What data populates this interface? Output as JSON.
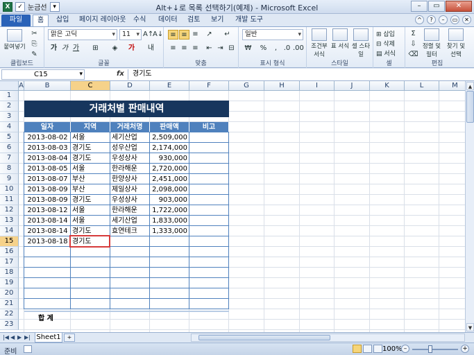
{
  "window": {
    "title": "Alt+↓로 목록 선택하기(예제) - Microsoft Excel",
    "qat_label": "눈금선"
  },
  "ribbon_tabs": [
    {
      "label": "파일"
    },
    {
      "label": "홈"
    },
    {
      "label": "삽입"
    },
    {
      "label": "페이지 레이아웃"
    },
    {
      "label": "수식"
    },
    {
      "label": "데이터"
    },
    {
      "label": "검토"
    },
    {
      "label": "보기"
    },
    {
      "label": "개발 도구"
    }
  ],
  "ribbon": {
    "clipboard": {
      "paste": "붙여넣기",
      "label": "클립보드"
    },
    "font": {
      "name": "맑은 고딕",
      "size": "11",
      "bold": "가",
      "italic": "가",
      "underline": "가",
      "label": "글꼴"
    },
    "alignment": {
      "label": "맞춤"
    },
    "number": {
      "format": "일반",
      "label": "표시 형식"
    },
    "styles": {
      "conditional": "조건부 서식",
      "table": "표 서식",
      "cell": "셀 스타일",
      "label": "스타일"
    },
    "cells": {
      "insert": "삽입",
      "delete": "삭제",
      "format": "서식",
      "label": "셀"
    },
    "editing": {
      "sort": "정렬 및 필터",
      "find": "찾기 및 선택",
      "label": "편집"
    }
  },
  "formula_bar": {
    "name_box": "C15",
    "fx": "fx",
    "value": "경기도"
  },
  "columns": [
    "A",
    "B",
    "C",
    "D",
    "E",
    "F",
    "G",
    "H",
    "I",
    "J",
    "K",
    "L",
    "M"
  ],
  "rows": [
    "1",
    "2",
    "3",
    "4",
    "5",
    "6",
    "7",
    "8",
    "9",
    "10",
    "11",
    "12",
    "13",
    "14",
    "15",
    "16",
    "17",
    "18",
    "19",
    "20",
    "21",
    "22",
    "23"
  ],
  "sheet": {
    "title": "거래처별 판매내역",
    "headers": [
      "일자",
      "지역",
      "거래처명",
      "판매액",
      "비고"
    ],
    "data": [
      [
        "2013-08-02",
        "서울",
        "세기산업",
        "2,509,000",
        ""
      ],
      [
        "2013-08-03",
        "경기도",
        "성우산업",
        "2,174,000",
        ""
      ],
      [
        "2013-08-04",
        "경기도",
        "우성상사",
        "930,000",
        ""
      ],
      [
        "2013-08-05",
        "서울",
        "한라해운",
        "2,720,000",
        ""
      ],
      [
        "2013-08-07",
        "부산",
        "한양상사",
        "2,451,000",
        ""
      ],
      [
        "2013-08-09",
        "부산",
        "제일상사",
        "2,098,000",
        ""
      ],
      [
        "2013-08-09",
        "경기도",
        "우성상사",
        "903,000",
        ""
      ],
      [
        "2013-08-12",
        "서울",
        "한라해운",
        "1,722,000",
        ""
      ],
      [
        "2013-08-14",
        "서울",
        "세기산업",
        "1,833,000",
        ""
      ],
      [
        "2013-08-14",
        "경기도",
        "효연테크",
        "1,333,000",
        ""
      ],
      [
        "2013-08-18",
        "경기도",
        "",
        "",
        ""
      ]
    ],
    "total_label": "합  계"
  },
  "sheet_tabs": [
    {
      "label": "Sheet1"
    }
  ],
  "status": {
    "ready": "준비",
    "zoom": "100%"
  }
}
